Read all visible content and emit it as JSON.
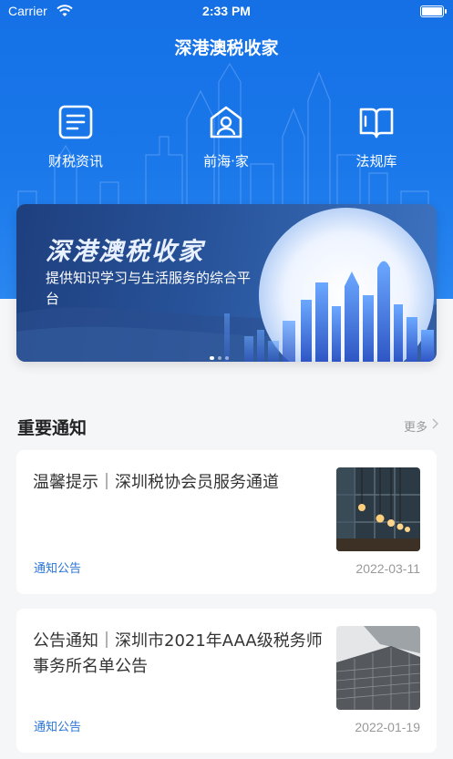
{
  "status": {
    "carrier": "Carrier",
    "time": "2:33 PM"
  },
  "header": {
    "title": "深港澳税收家"
  },
  "quick_links": [
    {
      "label": "财税资讯",
      "icon": "document-icon"
    },
    {
      "label": "前海·家",
      "icon": "house-person-icon"
    },
    {
      "label": "法规库",
      "icon": "book-icon"
    }
  ],
  "banner": {
    "title": "深港澳税收家",
    "subtitle": "提供知识学习与生活服务的综合平台"
  },
  "notices": {
    "title": "重要通知",
    "more": "更多",
    "items": [
      {
        "title": "温馨提示｜深圳税协会员服务通道",
        "tag": "通知公告",
        "date": "2022-03-11",
        "image": "office-interior-lights"
      },
      {
        "title": "公告通知｜深圳市2021年AAA级税务师事务所名单公告",
        "tag": "通知公告",
        "date": "2022-01-19",
        "image": "glass-building"
      }
    ]
  },
  "colors": {
    "primary": "#1a78ea",
    "tag": "#2a74d6",
    "background": "#f5f6f8"
  }
}
